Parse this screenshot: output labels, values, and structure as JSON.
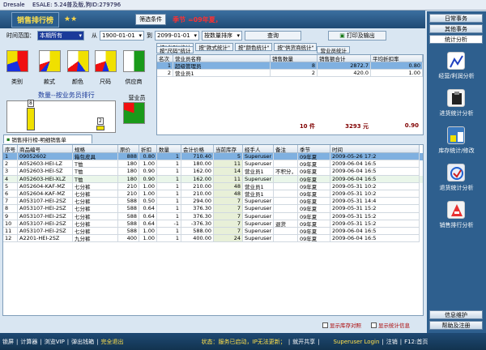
{
  "titlebar": {
    "app": "Dresale",
    "version": "ESALE: 5.24普及版,狗ID:279796"
  },
  "toolbar": {
    "logo": "销售排行榜",
    "stars": "★★",
    "filter_btn": "筛选条件",
    "season": "季节 =09年夏，"
  },
  "filters": {
    "range_label": "时间范围：",
    "range_value": "本期所有",
    "from_label": "从",
    "from_date": "1900-01-01",
    "to_label": "到",
    "to_date": "2099-01-01",
    "sort": "按数量排序",
    "query": "查询",
    "print": "打印及输出"
  },
  "pies": [
    {
      "label": "类别"
    },
    {
      "label": "款式"
    },
    {
      "label": "颜色"
    },
    {
      "label": "尺码"
    },
    {
      "label": "供应商"
    },
    {
      "label": "营业员"
    }
  ],
  "rank_chart": {
    "title": "数量--按业务员排行",
    "values": [
      8,
      2
    ]
  },
  "stat_buttons": {
    "row1": [
      "按\"类别\"统计",
      "按\"款式统计\"",
      "按\"颜色统计\"",
      "按\"供货商统计\""
    ],
    "row2": [
      "按\"尺码\"统计",
      "营业员统计"
    ]
  },
  "sum_table": {
    "headers": [
      "名次",
      "营业员名称",
      "销售数量",
      "销售额合计",
      "平均折扣率"
    ],
    "rows": [
      [
        "1",
        "超级管理员",
        "8",
        "2872.7",
        "0.80"
      ],
      [
        "2",
        "营业员1",
        "2",
        "420.0",
        "1.00"
      ]
    ],
    "footer": {
      "qty": "10 件",
      "amount": "3293 元",
      "rate": "0.90"
    }
  },
  "tab": "销售排行榜-明细销售单",
  "main": {
    "headers": [
      "序号",
      "商品编号",
      "规格",
      "原价",
      "折扣",
      "数量",
      "会计价格",
      "当前库存",
      "经手人",
      "备注",
      "季节",
      "时间"
    ],
    "rows": [
      [
        "1",
        "09052602",
        "箱包皮具",
        "888",
        "0.80",
        "1",
        "710.40",
        "5",
        "Superuser",
        "",
        "09年夏",
        "2009-05-26 17:2"
      ],
      [
        "2",
        "A052603-HEI-LZ",
        "T恤",
        "180",
        "1.00",
        "1",
        "180.00",
        "11",
        "Superuser",
        "",
        "09年夏",
        "2009-06-04 16:5"
      ],
      [
        "3",
        "A052603-HEI-SZ",
        "T恤",
        "180",
        "0.90",
        "1",
        "162.00",
        "14",
        "营业员1",
        "不积分，",
        "09年夏",
        "2009-06-04 16:5"
      ],
      [
        "4",
        "A052603-HEI-XLZ",
        "T恤",
        "180",
        "0.90",
        "1",
        "162.00",
        "11",
        "Superuser",
        "",
        "09年夏",
        "2009-06-04 16:5"
      ],
      [
        "5",
        "A052604-KAF-MZ",
        "七分裤",
        "210",
        "1.00",
        "1",
        "210.00",
        "48",
        "营业员1",
        "",
        "09年夏",
        "2009-05-31 10:2"
      ],
      [
        "6",
        "A052604-KAF-MZ",
        "七分裤",
        "210",
        "1.00",
        "1",
        "210.00",
        "48",
        "营业员1",
        "",
        "09年夏",
        "2009-05-31 10:2"
      ],
      [
        "7",
        "A053107-HEI-2SZ",
        "七分裤",
        "588",
        "0.50",
        "1",
        "294.00",
        "7",
        "Superuser",
        "",
        "09年夏",
        "2009-05-31 14:4"
      ],
      [
        "8",
        "A053107-HEI-2SZ",
        "七分裤",
        "588",
        "0.64",
        "1",
        "376.30",
        "7",
        "Superuser",
        "",
        "09年夏",
        "2009-05-31 15:2"
      ],
      [
        "9",
        "A053107-HEI-2SZ",
        "七分裤",
        "588",
        "0.64",
        "1",
        "376.30",
        "7",
        "Superuser",
        "",
        "09年夏",
        "2009-05-31 15:2"
      ],
      [
        "10",
        "A053107-HEI-2SZ",
        "七分裤",
        "588",
        "0.64",
        "-1",
        "-376.30",
        "7",
        "Superuser",
        "退货",
        "09年夏",
        "2009-05-31 15:2"
      ],
      [
        "11",
        "A053107-HEI-2SZ",
        "七分裤",
        "588",
        "1.00",
        "1",
        "588.00",
        "7",
        "Superuser",
        "",
        "09年夏",
        "2009-06-04 16:5"
      ],
      [
        "12",
        "A2201-HEI-2SZ",
        "九分裤",
        "400",
        "1.00",
        "1",
        "400.00",
        "24",
        "Superuser",
        "",
        "09年夏",
        "2009-06-04 16:5"
      ]
    ]
  },
  "checks": {
    "show_stock": "显示库存对照",
    "show_stats": "显示统计信息"
  },
  "statusbar": {
    "items": [
      "锁屏",
      "计算器",
      "浏览VIP",
      "弹出钱箱",
      "完全退出"
    ],
    "status": "状态：服务已启动，IP无法更新；",
    "share": "就开共享",
    "user": "Superuser Login",
    "logout": "注销",
    "help": "F12:首页"
  },
  "sidebar": {
    "tabs": [
      "日常事务",
      "其他事务",
      "统计分析"
    ],
    "items": [
      "经营/利润分析",
      "进货统计分析",
      "库存统计/修改",
      "退货统计分析",
      "销售排行分析"
    ],
    "bottom": [
      "信息维护",
      "帮助及注册"
    ]
  }
}
